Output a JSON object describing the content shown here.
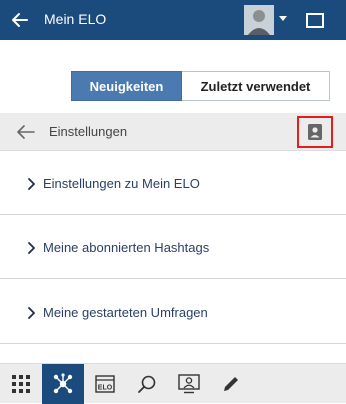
{
  "header": {
    "title": "Mein ELO",
    "back_icon": "arrow-left-icon",
    "avatar_icon": "user-avatar",
    "menu_icon": "window-icon"
  },
  "tabs": {
    "active_label": "Neuigkeiten",
    "inactive_label": "Zuletzt verwendet"
  },
  "settings_bar": {
    "label": "Einstellungen",
    "back_icon": "arrow-left-icon",
    "profile_icon": "contact-card-icon"
  },
  "list": [
    {
      "label": "Einstellungen zu Mein ELO"
    },
    {
      "label": "Meine abonnierten Hashtags"
    },
    {
      "label": "Meine gestarteten Umfragen"
    }
  ],
  "bottom_nav": {
    "items": [
      "apps-grid-icon",
      "network-icon",
      "elo-archive-icon",
      "search-icon",
      "person-screen-icon",
      "pen-icon"
    ],
    "archive_badge": "ELO"
  },
  "colors": {
    "header_bg": "#1b4a7c",
    "tab_active": "#4a7ab0",
    "highlight_border": "#e02020"
  }
}
